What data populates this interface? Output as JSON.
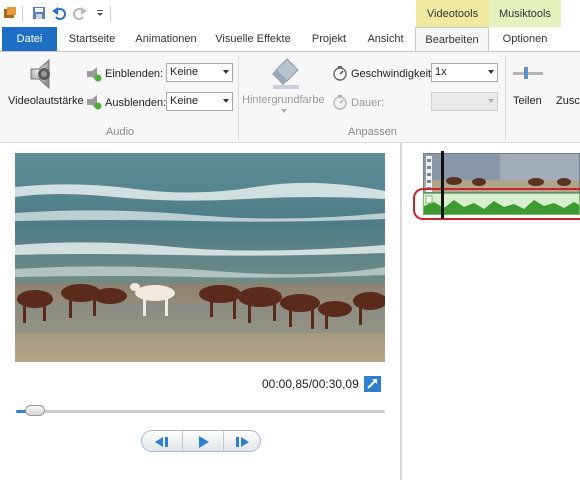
{
  "quick_access": {
    "icons": [
      "app-icon",
      "save-icon",
      "undo-icon",
      "redo-icon",
      "customize-icon"
    ]
  },
  "contextual_tabs": {
    "video_tools": "Videotools",
    "music_tools": "Musiktools",
    "video_tools_color": "#f0eaa0",
    "music_tools_color": "#e4f2bd"
  },
  "tabs": [
    {
      "label": "Datei"
    },
    {
      "label": "Startseite"
    },
    {
      "label": "Animationen"
    },
    {
      "label": "Visuelle Effekte"
    },
    {
      "label": "Projekt"
    },
    {
      "label": "Ansicht"
    },
    {
      "label": "Bearbeiten"
    },
    {
      "label": "Optionen"
    }
  ],
  "ribbon": {
    "audio": {
      "video_volume_label": "Videolautstärke",
      "fade_in_label": "Einblenden:",
      "fade_in_value": "Keine",
      "fade_out_label": "Ausblenden:",
      "fade_out_value": "Keine",
      "group_label": "Audio"
    },
    "adjust": {
      "background_color_label": "Hintergrundfarbe",
      "speed_label": "Geschwindigkeit:",
      "speed_value": "1x",
      "duration_label": "Dauer:",
      "duration_value": "",
      "group_label": "Anpassen"
    },
    "editing": {
      "split_label": "Teilen",
      "trim_label": "Zusch"
    }
  },
  "preview": {
    "timecode": "00:00,85/00:30,09",
    "seek_position": 0.03
  },
  "colors": {
    "accent": "#1e6fc3",
    "highlight_border": "#c8262a",
    "audio_track": "#3b9b2f"
  }
}
